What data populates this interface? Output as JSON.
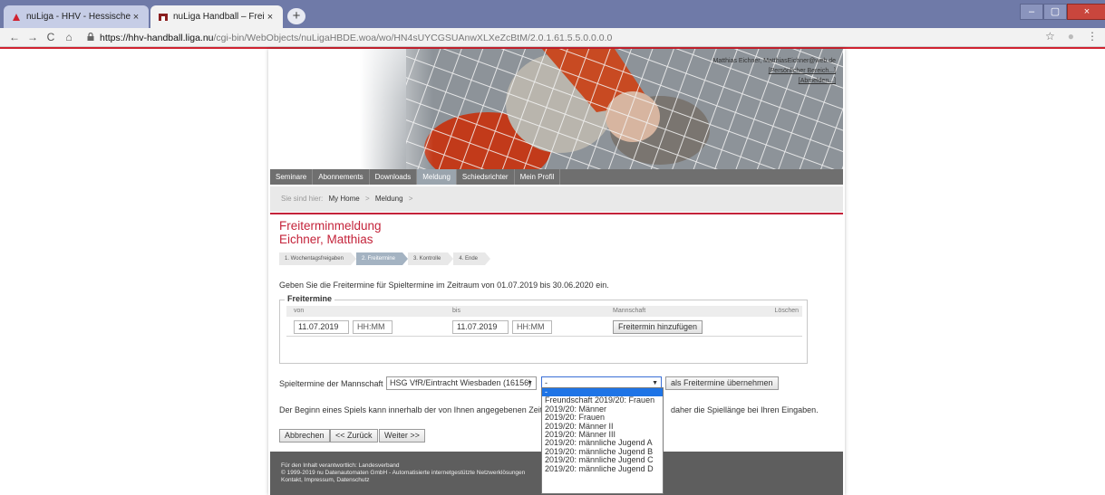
{
  "browser": {
    "tabs": [
      {
        "title": "nuLiga - HHV - Hessischer Handba",
        "close": "×"
      },
      {
        "title": "nuLiga Handball – Freiterminmel",
        "close": "×"
      }
    ],
    "new_tab": "+",
    "nav": {
      "back": "←",
      "forward": "→",
      "reload": "C",
      "home": "⌂"
    },
    "url": {
      "host": "https://hhv-handball.liga.nu",
      "path": "/cgi-bin/WebObjects/nuLigaHBDE.woa/wo/HN4sUYCGSUAnwXLXeZcBtM/2.0.1.61.5.5.0.0.0.0"
    },
    "toolbar_icons": {
      "star": "☆",
      "profile": "●",
      "menu": "⋮"
    },
    "window_controls": {
      "minimize": "–",
      "maximize": "▢",
      "close": "×"
    }
  },
  "header": {
    "user_line": "Matthias Eichner, MatthiasEichner@web.de",
    "personal_link": "[Persönlicher Bereich...]",
    "logout_link": "[Abmelden...]"
  },
  "menu": [
    {
      "label": "Seminare",
      "active": false
    },
    {
      "label": "Abonnements",
      "active": false
    },
    {
      "label": "Downloads",
      "active": false
    },
    {
      "label": "Meldung",
      "active": true
    },
    {
      "label": "Schiedsrichter",
      "active": false
    },
    {
      "label": "Mein Profil",
      "active": false
    }
  ],
  "breadcrumb": {
    "prefix": "Sie sind hier:",
    "items": [
      "My Home",
      "Meldung"
    ],
    "sep": ">"
  },
  "page": {
    "title": "Freiterminmeldung",
    "subtitle": "Eichner, Matthias",
    "steps": [
      {
        "label": "1. Wochentagsfreigaben",
        "current": false
      },
      {
        "label": "2. Freitermine",
        "current": true
      },
      {
        "label": "3. Kontrolle",
        "current": false
      },
      {
        "label": "4. Ende",
        "current": false
      }
    ],
    "intro": "Geben Sie die Freitermine für Spieltermine im Zeitraum von 01.07.2019 bis 30.06.2020 ein."
  },
  "freitermine": {
    "legend": "Freitermine",
    "columns": {
      "von": "von",
      "bis": "bis",
      "mannschaft": "Mannschaft",
      "loeschen": "Löschen"
    },
    "von_date": "11.07.2019",
    "von_time_placeholder": "HH:MM",
    "bis_date": "11.07.2019",
    "bis_time_placeholder": "HH:MM",
    "add_button": "Freitermin hinzufügen"
  },
  "team": {
    "label": "Spieltermine der Mannschaft",
    "team_select": "HSG VfR/Eintracht Wiesbaden (16156)",
    "competition_select": "-",
    "apply_button": "als Freitermine übernehmen",
    "arrow": "▼"
  },
  "note": "Der Beginn eines Spiels kann innerhalb der von Ihnen angegebenen Zeite",
  "note_end": "daher die Spiellänge bei Ihren Eingaben.",
  "buttons": {
    "cancel": "Abbrechen",
    "back": "<< Zurück",
    "next": "Weiter >>"
  },
  "footer": {
    "line1": "Für den Inhalt verantwortlich: Landesverband",
    "line2": "© 1999-2019 nu Datenautomaten GmbH - Automatisierte internetgestützte Netzwerklösungen",
    "line3": "Kontakt, Impressum, Datenschutz"
  },
  "dropdown_options": [
    "-",
    "Freundschaft 2019/20: Frauen",
    "2019/20: Männer",
    "2019/20: Frauen",
    "2019/20: Männer II",
    "2019/20: Männer III",
    "2019/20: männliche Jugend A",
    "2019/20: männliche Jugend B",
    "2019/20: männliche Jugend C",
    "2019/20: männliche Jugend D"
  ],
  "colors": {
    "accent_red": "#c4233a",
    "menu_bg": "#6f6f6f",
    "selected_blue": "#1e74e6"
  }
}
